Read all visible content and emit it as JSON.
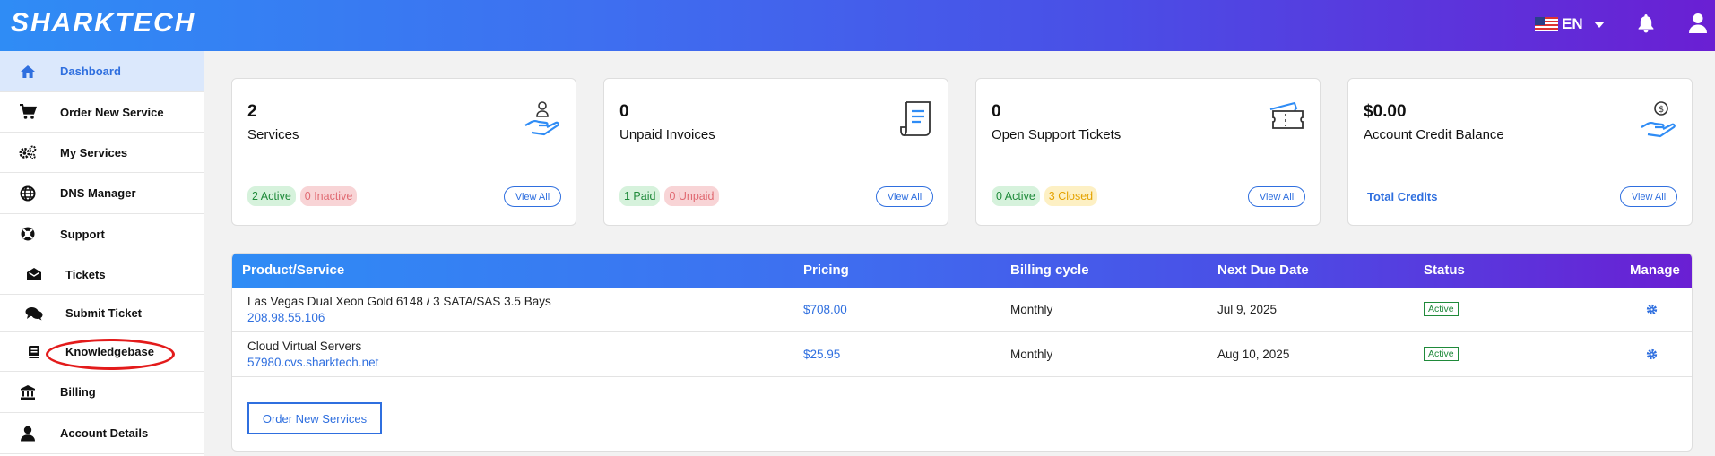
{
  "header": {
    "logo": "SHARKTECH",
    "language": "EN"
  },
  "sidebar": {
    "items": [
      {
        "label": "Dashboard",
        "icon": "home-icon"
      },
      {
        "label": "Order New Service",
        "icon": "cart-icon"
      },
      {
        "label": "My Services",
        "icon": "cogs-icon"
      },
      {
        "label": "DNS Manager",
        "icon": "globe-icon"
      },
      {
        "label": "Support",
        "icon": "life-ring-icon"
      },
      {
        "label": "Tickets",
        "icon": "envelope-open-icon"
      },
      {
        "label": "Submit Ticket",
        "icon": "comments-icon"
      },
      {
        "label": "Knowledgebase",
        "icon": "book-icon"
      },
      {
        "label": "Billing",
        "icon": "bank-icon"
      },
      {
        "label": "Account Details",
        "icon": "user-icon"
      }
    ]
  },
  "cards": [
    {
      "value": "2",
      "label": "Services",
      "badges": [
        "2 Active",
        "0 Inactive"
      ],
      "view_all": "View All",
      "icon": "hand-holding-user-icon"
    },
    {
      "value": "0",
      "label": "Unpaid Invoices",
      "badges": [
        "1 Paid",
        "0 Unpaid"
      ],
      "view_all": "View All",
      "icon": "receipt-icon"
    },
    {
      "value": "0",
      "label": "Open Support Tickets",
      "badges": [
        "0 Active",
        "3 Closed"
      ],
      "view_all": "View All",
      "icon": "ticket-icon"
    },
    {
      "value": "$0.00",
      "label": "Account Credit Balance",
      "link": "Total Credits",
      "view_all": "View All",
      "icon": "hand-holding-dollar-icon"
    }
  ],
  "table": {
    "headers": [
      "Product/Service",
      "Pricing",
      "Billing cycle",
      "Next Due Date",
      "Status",
      "Manage"
    ],
    "rows": [
      {
        "product": "Las Vegas Dual Xeon Gold 6148 / 3 SATA/SAS 3.5 Bays",
        "host": "208.98.55.106",
        "price": "$708.00",
        "cycle": "Monthly",
        "due": "Jul 9, 2025",
        "status": "Active"
      },
      {
        "product": "Cloud Virtual Servers",
        "host": "57980.cvs.sharktech.net",
        "price": "$25.95",
        "cycle": "Monthly",
        "due": "Aug 10, 2025",
        "status": "Active"
      }
    ],
    "order_button": "Order New Services"
  },
  "colors": {
    "accent": "#2f6fdf",
    "gradient_start": "#2f8cf5",
    "gradient_end": "#6a1fd3",
    "highlight": "#e31b1b"
  }
}
